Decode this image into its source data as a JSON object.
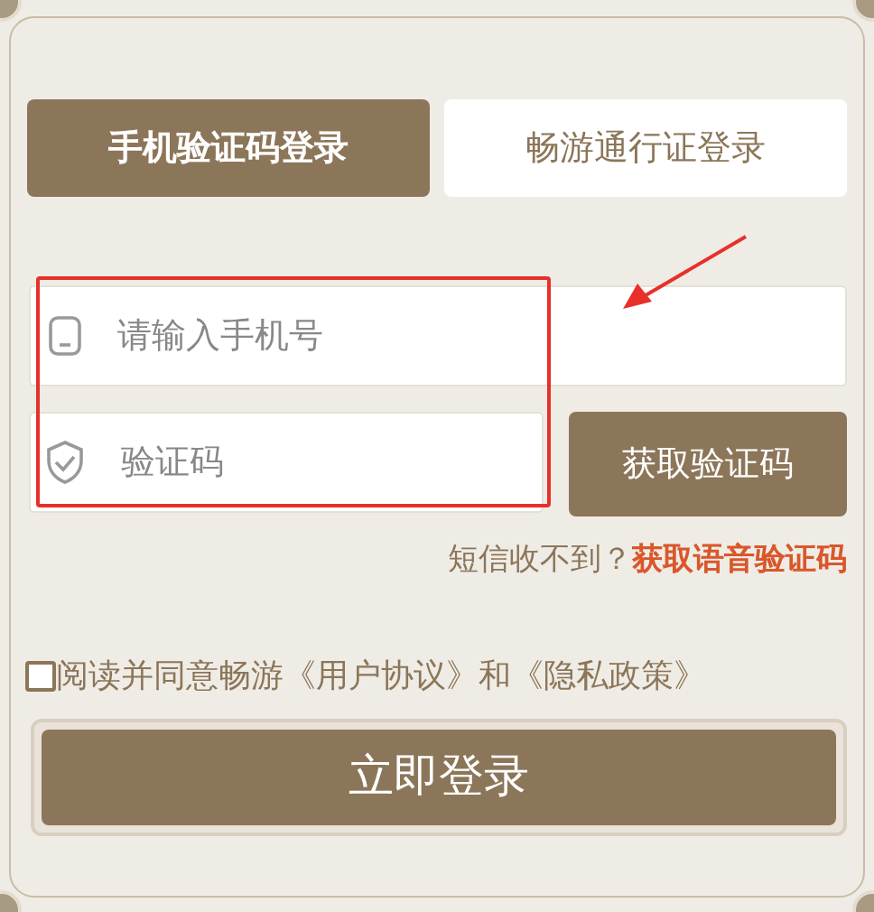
{
  "tabs": [
    {
      "label": "手机验证码登录",
      "selected": true
    },
    {
      "label": "畅游通行证登录",
      "selected": false
    }
  ],
  "phone_field": {
    "placeholder": "请输入手机号"
  },
  "code_field": {
    "placeholder": "验证码"
  },
  "get_code_button": "获取验证码",
  "voice_hint": {
    "text": "短信收不到？",
    "link": "获取语音验证码"
  },
  "agreement": {
    "checked": false,
    "text": "阅读并同意畅游《用户协议》和《隐私政策》"
  },
  "login_button": "立即登录"
}
